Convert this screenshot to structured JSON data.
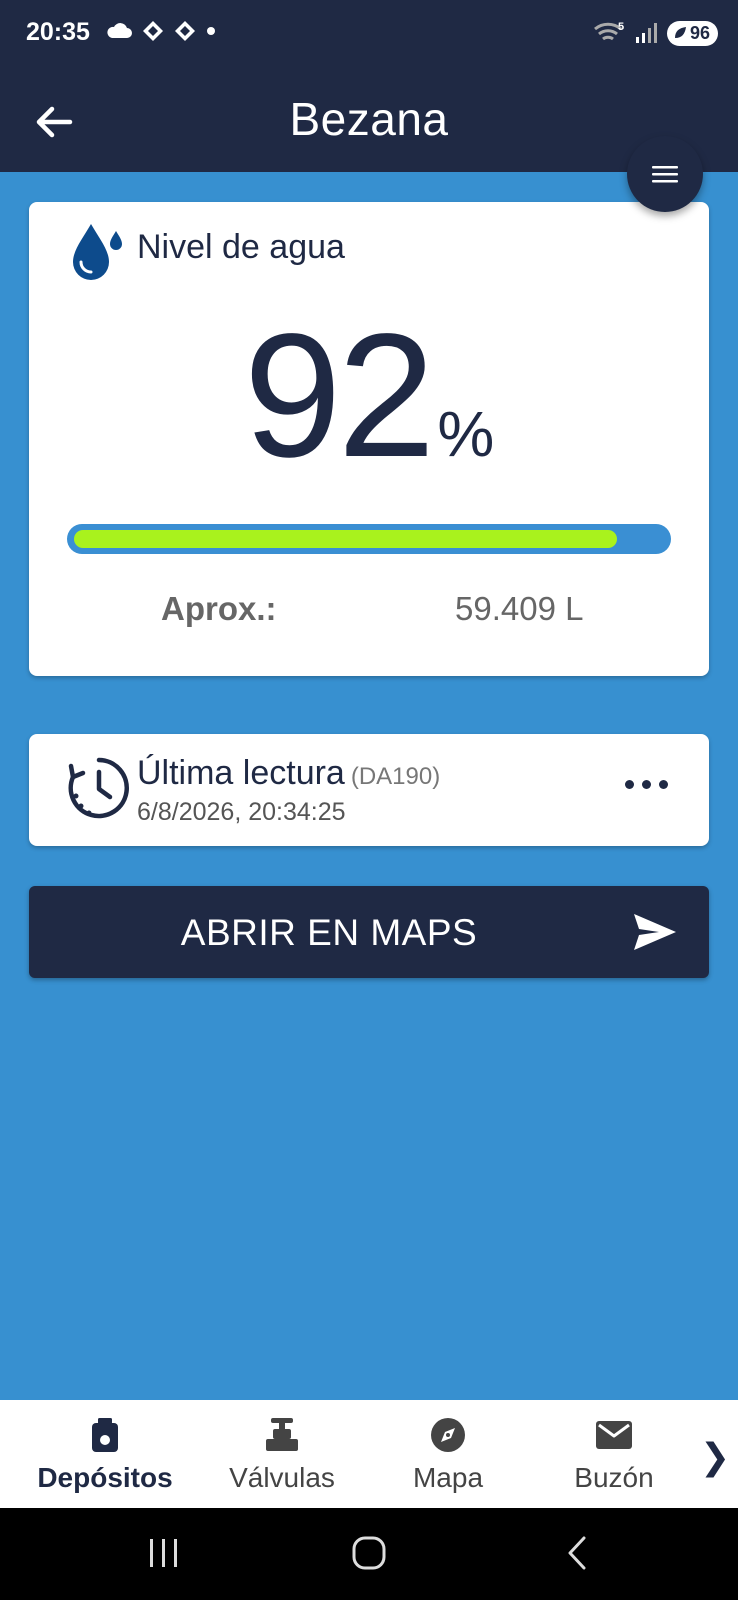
{
  "status_bar": {
    "time": "20:35",
    "battery": "96",
    "signal_badge": "5"
  },
  "app_bar": {
    "title": "Bezana"
  },
  "level_card": {
    "label": "Nivel de agua",
    "percent": "92",
    "unit": "%",
    "fill_fraction": 0.92,
    "approx_label": "Aprox.:",
    "approx_value": "59.409 L",
    "colors": {
      "fill": "#a9f21d",
      "track": "#3a8fd3"
    }
  },
  "reading_card": {
    "title": "Última lectura",
    "code": "(DA190)",
    "timestamp": "6/8/2026, 20:34:25"
  },
  "maps_button": {
    "label": "ABRIR EN MAPS"
  },
  "bottom_nav": {
    "items": [
      {
        "label": "Depósitos",
        "icon": "tank-icon",
        "active": true
      },
      {
        "label": "Válvulas",
        "icon": "valve-icon",
        "active": false
      },
      {
        "label": "Mapa",
        "icon": "compass-icon",
        "active": false
      },
      {
        "label": "Buzón",
        "icon": "mail-icon",
        "active": false
      }
    ],
    "next": "❯"
  },
  "colors": {
    "primary": "#1f2944",
    "background": "#3790d0"
  }
}
